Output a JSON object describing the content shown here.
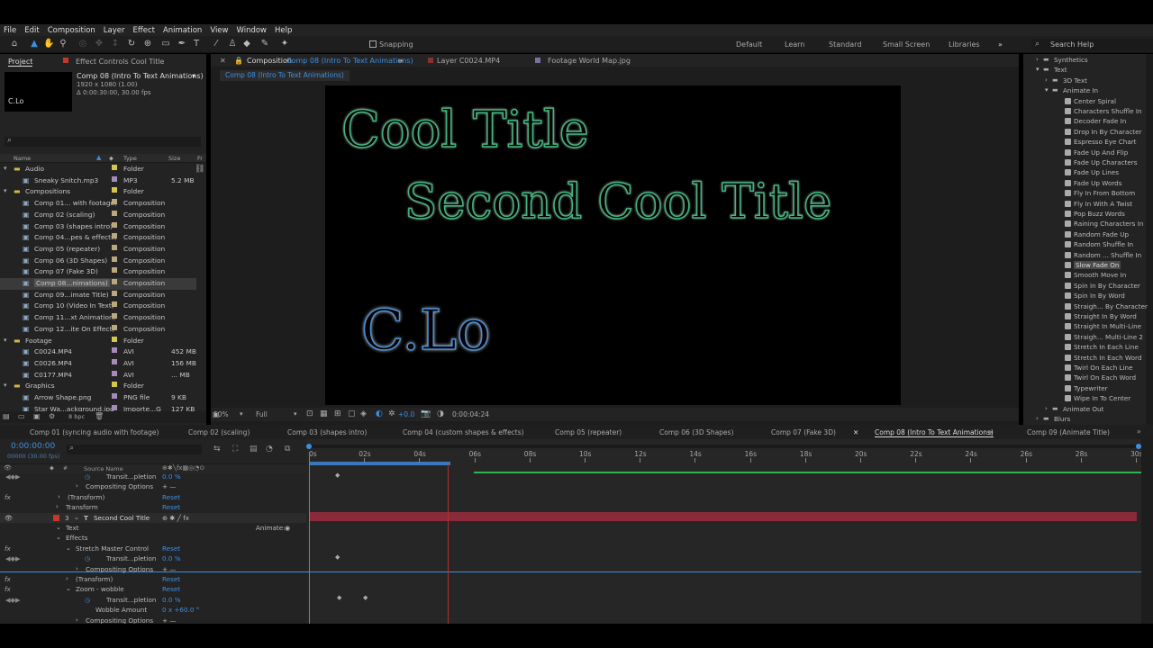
{
  "menu": [
    "File",
    "Edit",
    "Composition",
    "Layer",
    "Effect",
    "Animation",
    "View",
    "Window",
    "Help"
  ],
  "toolbar": {
    "snapping": "Snapping",
    "workspaces": [
      "Default",
      "Learn",
      "Standard",
      "Small Screen",
      "Libraries"
    ],
    "search_placeholder": "Search Help"
  },
  "project": {
    "tab_project": "Project",
    "tab_effect_controls": "Effect Controls Cool Title",
    "thumb_text": "C.Lo",
    "comp_name": "Comp 08 (Intro To Text Animations)",
    "comp_res": "1920 x 1080 (1.00)",
    "comp_dur": "Δ 0:00:30:00, 30.00 fps",
    "columns": {
      "name": "Name",
      "type": "Type",
      "size": "Size",
      "fr": "Fr"
    },
    "items": [
      {
        "name": "Audio",
        "type": "Folder",
        "size": "",
        "folder": true
      },
      {
        "name": "Sneaky Snitch.mp3",
        "type": "MP3",
        "size": "5.2 MB"
      },
      {
        "name": "Compositions",
        "type": "Folder",
        "size": "",
        "folder": true
      },
      {
        "name": "Comp 01... with footage)",
        "type": "Composition",
        "size": ""
      },
      {
        "name": "Comp 02 (scaling)",
        "type": "Composition",
        "size": ""
      },
      {
        "name": "Comp 03 (shapes intro)",
        "type": "Composition",
        "size": ""
      },
      {
        "name": "Comp 04...pes & effects)",
        "type": "Composition",
        "size": ""
      },
      {
        "name": "Comp 05 (repeater)",
        "type": "Composition",
        "size": ""
      },
      {
        "name": "Comp 06 (3D Shapes)",
        "type": "Composition",
        "size": ""
      },
      {
        "name": "Comp 07 (Fake 3D)",
        "type": "Composition",
        "size": ""
      },
      {
        "name": "Comp 08...nimations)",
        "type": "Composition",
        "size": "",
        "selected": true
      },
      {
        "name": "Comp 09...imate Title)",
        "type": "Composition",
        "size": ""
      },
      {
        "name": "Comp 10 (Video In Text)",
        "type": "Composition",
        "size": ""
      },
      {
        "name": "Comp 11...xt Animation)",
        "type": "Composition",
        "size": ""
      },
      {
        "name": "Comp 12...ite On Effect)",
        "type": "Composition",
        "size": ""
      },
      {
        "name": "Footage",
        "type": "Folder",
        "size": "",
        "folder": true
      },
      {
        "name": "C0024.MP4",
        "type": "AVI",
        "size": "452 MB"
      },
      {
        "name": "C0026.MP4",
        "type": "AVI",
        "size": "156 MB"
      },
      {
        "name": "C0177.MP4",
        "type": "AVI",
        "size": "... MB"
      },
      {
        "name": "Graphics",
        "type": "Folder",
        "size": "",
        "folder": true
      },
      {
        "name": "Arrow Shape.png",
        "type": "PNG file",
        "size": "9 KB"
      },
      {
        "name": "Star Wa...ackground.jpg",
        "type": "Importe...G",
        "size": "127 KB"
      }
    ],
    "bpc": "8 bpc"
  },
  "viewer": {
    "tab_comp": "Composition",
    "tab_comp_name": "Comp 08 (Intro To Text Animations)",
    "tab_layer": "Layer C0024.MP4",
    "tab_footage": "Footage World Map.jpg",
    "breadcrumb": "Comp 08 (Intro To Text Animations)",
    "title1": "Cool Title",
    "title2": "Second Cool Title",
    "title3": "C.Lo",
    "zoom": "50%",
    "quality": "Full",
    "exposure": "+0.0",
    "timecode": "0:00:04:24"
  },
  "effects": {
    "items": [
      "Synthetics",
      "Text",
      "3D Text",
      "Animate In",
      "Center Spiral",
      "Characters Shuffle In",
      "Decoder Fade In",
      "Drop In By Character",
      "Espresso Eye Chart",
      "Fade Up And Flip",
      "Fade Up Characters",
      "Fade Up Lines",
      "Fade Up Words",
      "Fly In From Bottom",
      "Fly In With A Twist",
      "Pop Buzz Words",
      "Raining Characters In",
      "Random Fade Up",
      "Random Shuffle In",
      "Random ... Shuffle In",
      "Slow Fade On",
      "Smooth Move In",
      "Spin In By Character",
      "Spin In By Word",
      "Straigh... By Character",
      "Straight In By Word",
      "Straight In Multi-Line",
      "Straigh... Multi-Line 2",
      "Stretch In Each Line",
      "Stretch In Each Word",
      "Twirl On Each Line",
      "Twirl On Each Word",
      "Typewriter",
      "Wipe In To Center",
      "Animate Out",
      "Blurs"
    ]
  },
  "timeline": {
    "tabs": [
      "Comp 01 (syncing audio with footage)",
      "Comp 02 (scaling)",
      "Comp 03 (shapes intro)",
      "Comp 04 (custom shapes & effects)",
      "Comp 05 (repeater)",
      "Comp 06 (3D Shapes)",
      "Comp 07 (Fake 3D)",
      "Comp 08 (Intro To Text Animations)",
      "Comp 09 (Animate Title)"
    ],
    "time": "0:00:00:00",
    "frames": "00000 (30.00 fps)",
    "source_name": "Source Name",
    "ruler": [
      "0s",
      "02s",
      "04s",
      "06s",
      "08s",
      "10s",
      "12s",
      "14s",
      "16s",
      "18s",
      "20s",
      "22s",
      "24s",
      "26s",
      "28s",
      "30s"
    ],
    "rows": [
      {
        "label": "Transit...pletion",
        "value": "0.0 %"
      },
      {
        "label": "Compositing Options",
        "value": "+ —"
      },
      {
        "label": "(Transform)",
        "value": "Reset"
      },
      {
        "label": "Transform",
        "value": "Reset"
      },
      {
        "label": "Second Cool Title",
        "value": "",
        "index": "3"
      },
      {
        "label": "Text",
        "value": "Animate:"
      },
      {
        "label": "Effects",
        "value": ""
      },
      {
        "label": "Stretch Master Control",
        "value": "Reset"
      },
      {
        "label": "Transit...pletion",
        "value": "0.0 %"
      },
      {
        "label": "Compositing Options",
        "value": "+ —"
      },
      {
        "label": "(Transform)",
        "value": "Reset"
      },
      {
        "label": "Zoom - wobble",
        "value": "Reset"
      },
      {
        "label": "Transit...pletion",
        "value": "0.0 %"
      },
      {
        "label": "Wobble Amount",
        "value": "0 x +60.0 °"
      },
      {
        "label": "Compositing Options",
        "value": "+ —"
      }
    ]
  }
}
